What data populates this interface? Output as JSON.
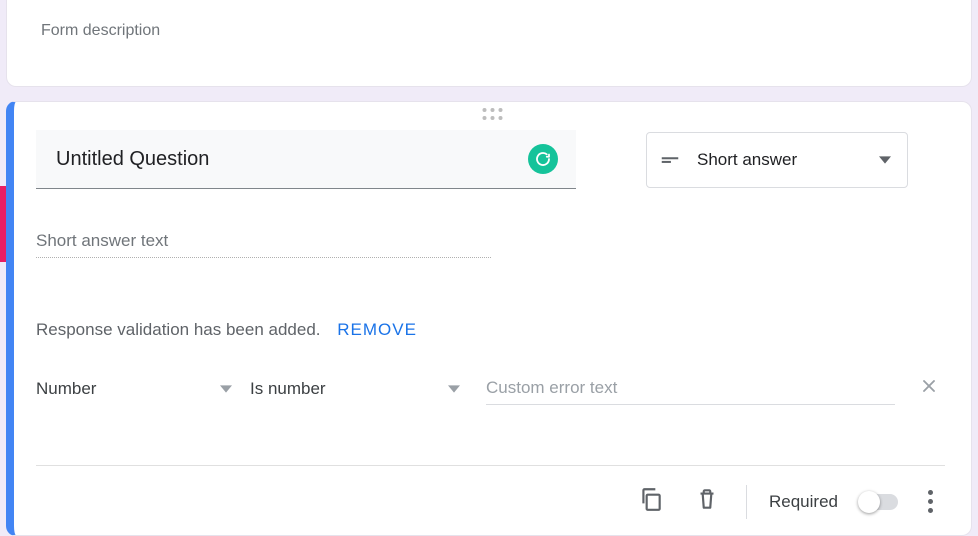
{
  "header": {
    "form_description_placeholder": "Form description"
  },
  "question": {
    "title_value": "Untitled Question",
    "answer_preview": "Short answer text",
    "type": {
      "selected_label": "Short answer"
    },
    "validation": {
      "message": "Response validation has been added.",
      "remove_label": "REMOVE",
      "type_selected": "Number",
      "condition_selected": "Is number",
      "error_placeholder": "Custom error text"
    },
    "footer": {
      "required_label": "Required",
      "required_on": false
    }
  }
}
